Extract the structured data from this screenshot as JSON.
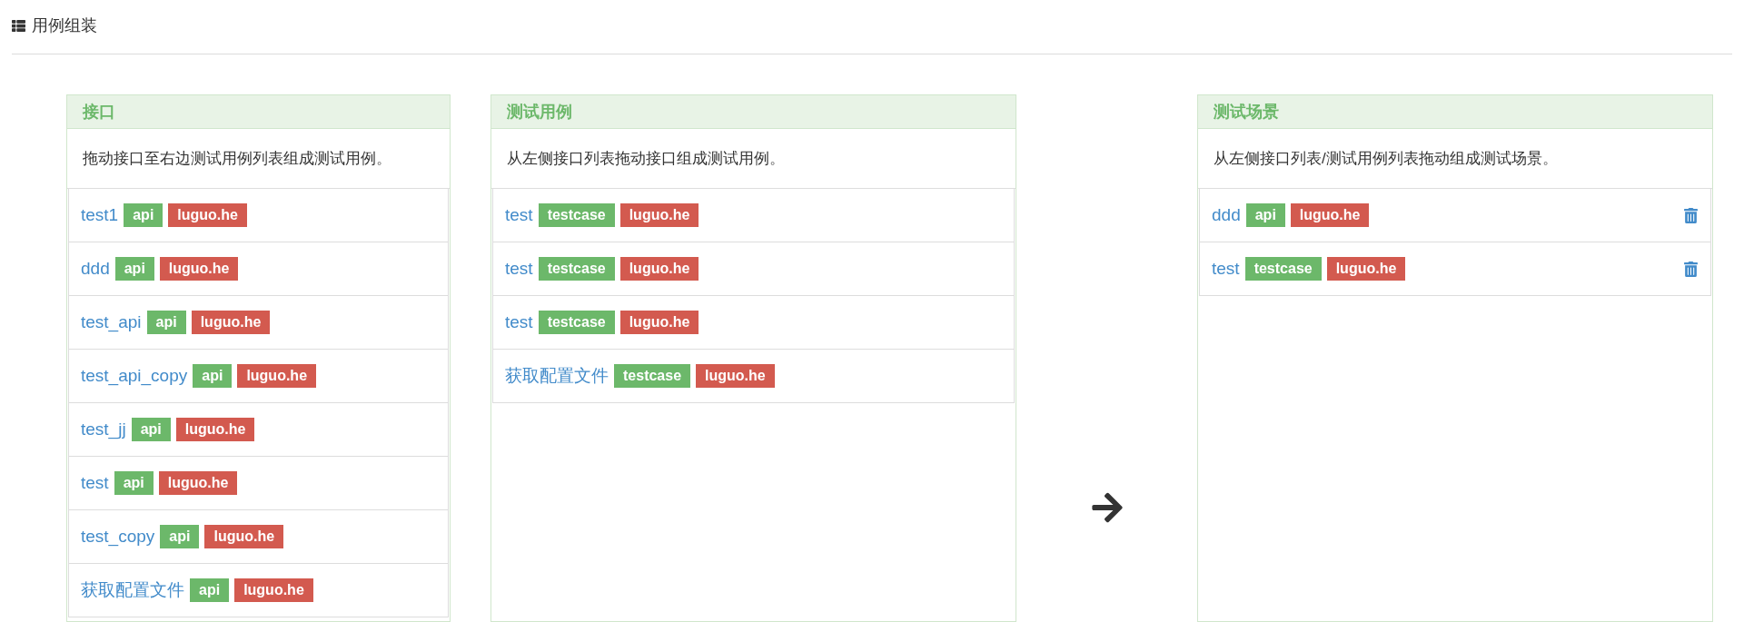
{
  "page_title": "用例组装",
  "panels": [
    {
      "heading": "接口",
      "description": "拖动接口至右边测试用例列表组成测试用例。",
      "items": [
        {
          "name": "test1",
          "removable": false,
          "tags": [
            {
              "text": "api",
              "kind": "type"
            },
            {
              "text": "luguo.he",
              "kind": "owner"
            }
          ]
        },
        {
          "name": "ddd",
          "removable": false,
          "tags": [
            {
              "text": "api",
              "kind": "type"
            },
            {
              "text": "luguo.he",
              "kind": "owner"
            }
          ]
        },
        {
          "name": "test_api",
          "removable": false,
          "tags": [
            {
              "text": "api",
              "kind": "type"
            },
            {
              "text": "luguo.he",
              "kind": "owner"
            }
          ]
        },
        {
          "name": "test_api_copy",
          "removable": false,
          "tags": [
            {
              "text": "api",
              "kind": "type"
            },
            {
              "text": "luguo.he",
              "kind": "owner"
            }
          ]
        },
        {
          "name": "test_jj",
          "removable": false,
          "tags": [
            {
              "text": "api",
              "kind": "type"
            },
            {
              "text": "luguo.he",
              "kind": "owner"
            }
          ]
        },
        {
          "name": "test",
          "removable": false,
          "tags": [
            {
              "text": "api",
              "kind": "type"
            },
            {
              "text": "luguo.he",
              "kind": "owner"
            }
          ]
        },
        {
          "name": "test_copy",
          "removable": false,
          "tags": [
            {
              "text": "api",
              "kind": "type"
            },
            {
              "text": "luguo.he",
              "kind": "owner"
            }
          ]
        },
        {
          "name": "获取配置文件",
          "removable": false,
          "tags": [
            {
              "text": "api",
              "kind": "type"
            },
            {
              "text": "luguo.he",
              "kind": "owner"
            }
          ]
        }
      ]
    },
    {
      "heading": "测试用例",
      "description": "从左侧接口列表拖动接口组成测试用例。",
      "items": [
        {
          "name": "test",
          "removable": false,
          "tags": [
            {
              "text": "testcase",
              "kind": "type"
            },
            {
              "text": "luguo.he",
              "kind": "owner"
            }
          ]
        },
        {
          "name": "test",
          "removable": false,
          "tags": [
            {
              "text": "testcase",
              "kind": "type"
            },
            {
              "text": "luguo.he",
              "kind": "owner"
            }
          ]
        },
        {
          "name": "test",
          "removable": false,
          "tags": [
            {
              "text": "testcase",
              "kind": "type"
            },
            {
              "text": "luguo.he",
              "kind": "owner"
            }
          ]
        },
        {
          "name": "获取配置文件",
          "removable": false,
          "tags": [
            {
              "text": "testcase",
              "kind": "type"
            },
            {
              "text": "luguo.he",
              "kind": "owner"
            }
          ]
        }
      ]
    },
    {
      "heading": "测试场景",
      "description": "从左侧接口列表/测试用例列表拖动组成测试场景。",
      "items": [
        {
          "name": "ddd",
          "removable": true,
          "tags": [
            {
              "text": "api",
              "kind": "type"
            },
            {
              "text": "luguo.he",
              "kind": "owner"
            }
          ]
        },
        {
          "name": "test",
          "removable": true,
          "tags": [
            {
              "text": "testcase",
              "kind": "type"
            },
            {
              "text": "luguo.he",
              "kind": "owner"
            }
          ]
        }
      ]
    }
  ]
}
